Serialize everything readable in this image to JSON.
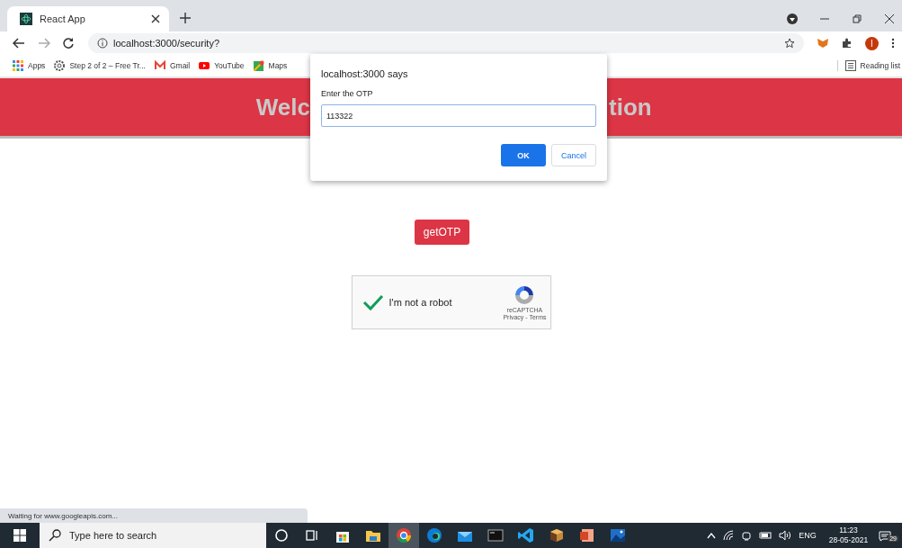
{
  "tab": {
    "title": "React App"
  },
  "address_bar": {
    "url": "localhost:3000/security?"
  },
  "bookmarks": [
    {
      "label": "Apps",
      "kind": "apps"
    },
    {
      "label": "Step 2 of 2 – Free Tr...",
      "kind": "gear"
    },
    {
      "label": "Gmail",
      "kind": "gmail"
    },
    {
      "label": "YouTube",
      "kind": "youtube"
    },
    {
      "label": "Maps",
      "kind": "maps"
    }
  ],
  "reading_list": "Reading list",
  "profile_initial": "I",
  "header": {
    "visible_left": "Welc",
    "visible_right": "tion"
  },
  "get_otp_button": "getOTP",
  "captcha": {
    "label": "I'm not a robot",
    "checked": true,
    "brand": "reCAPTCHA",
    "links": "Privacy - Terms"
  },
  "dialog": {
    "title": "localhost:3000 says",
    "message": "Enter the OTP",
    "value": "113322",
    "ok": "OK",
    "cancel": "Cancel"
  },
  "status_text": "Waiting for www.googleapis.com...",
  "taskbar": {
    "search_placeholder": "Type here to search",
    "apps": [
      {
        "kind": "cortana",
        "active": false
      },
      {
        "kind": "taskview",
        "active": false
      },
      {
        "kind": "store",
        "active": false
      },
      {
        "kind": "folder",
        "active": false
      },
      {
        "kind": "chrome",
        "active": true
      },
      {
        "kind": "edge",
        "active": false
      },
      {
        "kind": "mail",
        "active": false
      },
      {
        "kind": "terminal",
        "active": false
      },
      {
        "kind": "vscode",
        "active": false
      },
      {
        "kind": "box",
        "active": false
      },
      {
        "kind": "office",
        "active": false
      },
      {
        "kind": "photos",
        "active": false
      }
    ],
    "language": "ENG",
    "time": "11:23",
    "date": "28-05-2021",
    "notifications": "29"
  }
}
